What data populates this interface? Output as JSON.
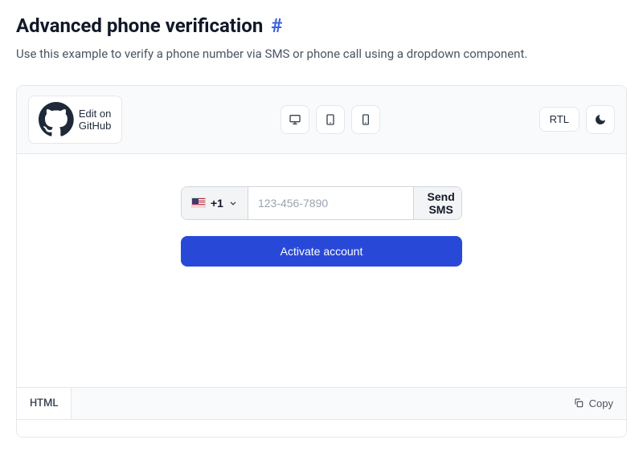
{
  "heading": {
    "title": "Advanced phone verification",
    "anchor": "#"
  },
  "lead": "Use this example to verify a phone number via SMS or phone call using a dropdown component.",
  "toolbar": {
    "edit_label": "Edit on GitHub",
    "rtl_label": "RTL"
  },
  "demo": {
    "country_code": "+1",
    "phone_placeholder": "123-456-7890",
    "send_label": "Send SMS",
    "activate_label": "Activate account"
  },
  "codearea": {
    "tab_label": "HTML",
    "copy_label": "Copy",
    "snippet_preview": ""
  }
}
